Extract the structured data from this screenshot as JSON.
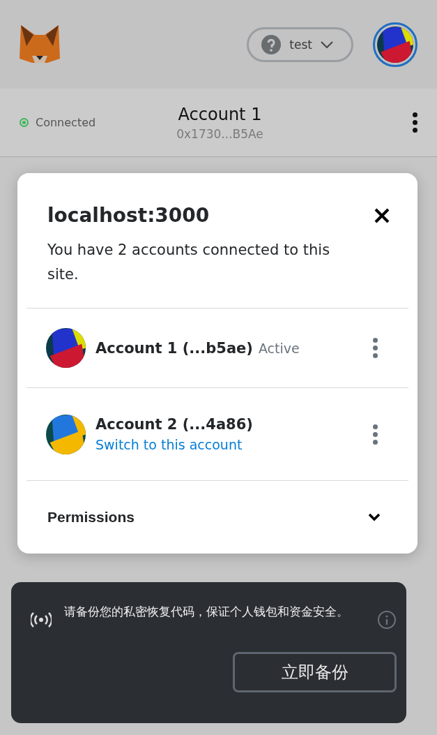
{
  "header": {
    "network": {
      "label": "test"
    }
  },
  "account_bar": {
    "status": "Connected",
    "connected": true,
    "name": "Account 1",
    "address": "0x1730...B5Ae"
  },
  "modal": {
    "title": "localhost:3000",
    "description": "You have 2 accounts connected to this site.",
    "accounts": [
      {
        "name": "Account 1 (...b5ae)",
        "active": true,
        "status": "Active"
      },
      {
        "name": "Account 2 (...4a86)",
        "active": false,
        "action": "Switch to this account"
      }
    ],
    "permissions": {
      "label": "Permissions",
      "expanded": false
    }
  },
  "toast": {
    "message": "请备份您的私密恢复代码，保证个人钱包和资金安全。",
    "button": "立即备份"
  }
}
